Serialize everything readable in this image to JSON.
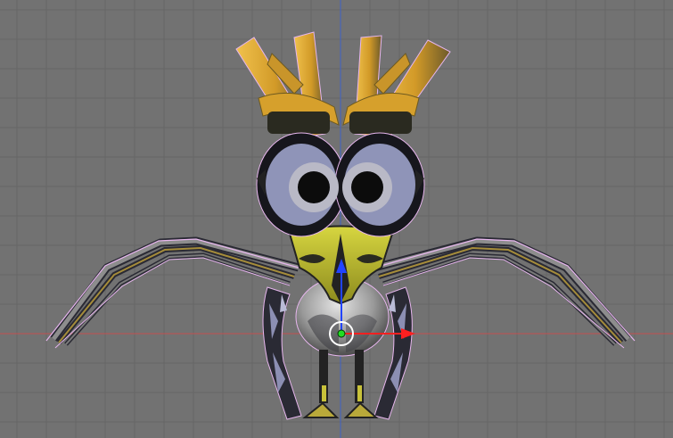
{
  "viewport": {
    "background": "#727272",
    "grid_color": "#666666",
    "x_axis_color": "#c25050",
    "z_axis_color": "#3f62c6"
  },
  "model": {
    "antler_color": "#d9a12e",
    "antler_shadow": "#7a6a36",
    "eye_ring": "#8f94b8",
    "eye_iris": "#b9b9c6",
    "beak_color": "#c2c233",
    "body_color": "#9a9a9a",
    "wing_dark": "#2a2a34",
    "wing_light": "#8c8fb3",
    "selection_outline": "#e7b6ee"
  },
  "manipulator": {
    "x_handle": "red",
    "y_handle": "green",
    "z_handle": "blue"
  }
}
